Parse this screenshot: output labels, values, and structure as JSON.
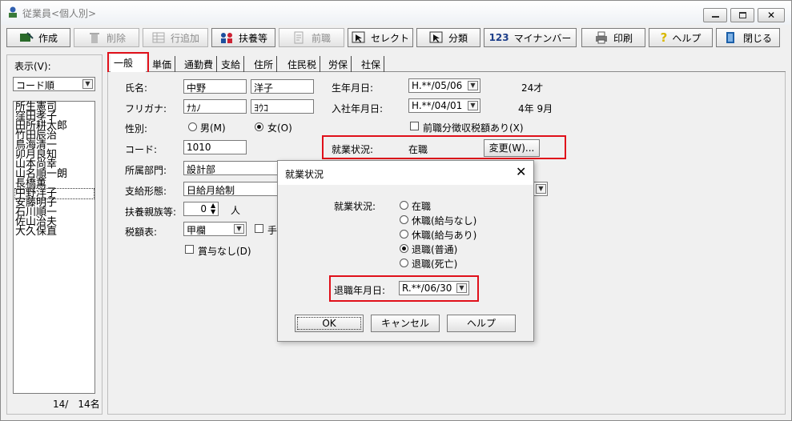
{
  "window": {
    "title": "従業員<個人別>"
  },
  "toolbar": {
    "create": "作成",
    "delete": "削除",
    "add_row": "行追加",
    "dependents": "扶養等",
    "previous_job": "前職",
    "select": "セレクト",
    "classification": "分類",
    "mynumber": "マイナンバー",
    "print": "印刷",
    "help": "ヘルプ",
    "close": "閉じる"
  },
  "left": {
    "display_label": "表示(V):",
    "sort_value": "コード順",
    "employees": [
      "所生憲司",
      "窪田孝子",
      "田所耕太郎",
      "竹田辰治",
      "鳥海清一",
      "卯月良知",
      "山本尚幸",
      "山名順一朗",
      "長橋薫",
      "中野洋子",
      "安藤明子",
      "石川順一",
      "佐山治夫",
      "大久保直"
    ],
    "selected_index": 9,
    "count_text": "14/　14名"
  },
  "tabs": [
    "一般",
    "単価",
    "通勤費",
    "支給",
    "住所",
    "住民税",
    "労保",
    "社保"
  ],
  "form": {
    "name_label": "氏名:",
    "last_name": "中野",
    "first_name": "洋子",
    "kana_label": "フリガナ:",
    "last_kana": "ﾅｶﾉ",
    "first_kana": "ﾖｳｺ",
    "gender_label": "性別:",
    "male": "男(M)",
    "female": "女(O)",
    "code_label": "コード:",
    "code": "1010",
    "dept_label": "所属部門:",
    "dept": "設計部",
    "pay_type_label": "支給形態:",
    "pay_type": "日給月給制",
    "dependents_label": "扶養親族等:",
    "dependents_count": "0",
    "dependents_unit": "人",
    "tax_table_label": "税額表:",
    "tax_table": "甲欄",
    "hand_label": "手",
    "no_bonus": "賞与なし(D)",
    "birth_label": "生年月日:",
    "birth": "H.**/05/06",
    "age": "24才",
    "hire_label": "入社年月日:",
    "hire": "H.**/04/01",
    "tenure": "4年 9月",
    "prev_tax": "前職分徴収税額あり(X)",
    "status_label": "就業状況:",
    "status_value": "在職",
    "change_button": "変更(W)..."
  },
  "dialog": {
    "title": "就業状況",
    "status_label": "就業状況:",
    "options": [
      "在職",
      "休職(給与なし)",
      "休職(給与あり)",
      "退職(普通)",
      "退職(死亡)"
    ],
    "selected": 3,
    "retire_label": "退職年月日:",
    "retire_date": "R.**/06/30",
    "ok": "OK",
    "cancel": "キャンセル",
    "help": "ヘルプ"
  },
  "colors": {
    "highlight": "#e0101a"
  }
}
